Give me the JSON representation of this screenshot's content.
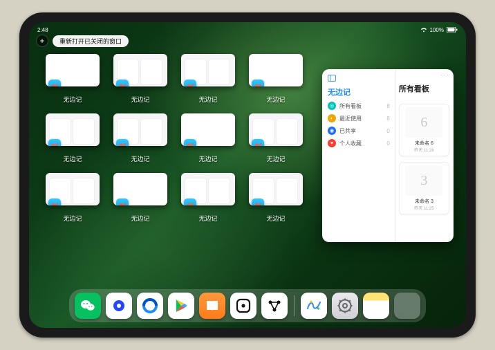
{
  "status": {
    "time": "2:48",
    "battery": "100%"
  },
  "controls": {
    "add_label": "+",
    "reopen_label": "重新打开已关闭的窗口"
  },
  "app_window_label": "无边记",
  "app_windows": [
    {
      "variant": "blank"
    },
    {
      "variant": "cards"
    },
    {
      "variant": "cards"
    },
    {
      "variant": "blank"
    },
    {
      "variant": "cards"
    },
    {
      "variant": "cards"
    },
    {
      "variant": "blank"
    },
    {
      "variant": "cards"
    },
    {
      "variant": "cards"
    },
    {
      "variant": "blank"
    },
    {
      "variant": "cards"
    },
    {
      "variant": "cards"
    }
  ],
  "panel": {
    "left_title": "无边记",
    "right_title": "所有看板",
    "ellipsis": "···",
    "items": [
      {
        "icon_color": "#00c3b7",
        "glyph": "◎",
        "label": "所有看板",
        "count": "8"
      },
      {
        "icon_color": "#f0a500",
        "glyph": "◐",
        "label": "最近使用",
        "count": "8"
      },
      {
        "icon_color": "#1f6ef0",
        "glyph": "◉",
        "label": "已共享",
        "count": "0"
      },
      {
        "icon_color": "#ff3b30",
        "glyph": "♥",
        "label": "个人收藏",
        "count": "0"
      }
    ],
    "boards": [
      {
        "doodle": "6",
        "name": "未命名 6",
        "sub": "昨天 11:28"
      },
      {
        "doodle": "3",
        "name": "未命名 3",
        "sub": "昨天 11:25"
      }
    ]
  },
  "dock": [
    {
      "name": "wechat",
      "bg": "#07c160",
      "content_svg": "wechat"
    },
    {
      "name": "qqhd",
      "bg": "#ffffff",
      "content_svg": "qblue"
    },
    {
      "name": "qqbrowser",
      "bg": "#ffffff",
      "content_svg": "qqbrowser"
    },
    {
      "name": "play",
      "bg": "#ffffff",
      "content_svg": "play"
    },
    {
      "name": "books",
      "bg": "linear-gradient(180deg,#ff9a3c,#ff7a1a)",
      "content_svg": "books"
    },
    {
      "name": "dice",
      "bg": "#ffffff",
      "content_svg": "dice"
    },
    {
      "name": "nodes",
      "bg": "#ffffff",
      "content_svg": "nodes"
    },
    {
      "name": "sep"
    },
    {
      "name": "freeform",
      "bg": "#ffffff",
      "content_svg": "freeform"
    },
    {
      "name": "settings",
      "bg": "linear-gradient(180deg,#e9e9ee,#cfcfd6)",
      "content_svg": "gear"
    },
    {
      "name": "notes",
      "bg": "linear-gradient(180deg,#ffe475 0 30%,#fff 30%)",
      "content_svg": ""
    },
    {
      "name": "app-library",
      "bg": "quad",
      "content_svg": ""
    }
  ]
}
